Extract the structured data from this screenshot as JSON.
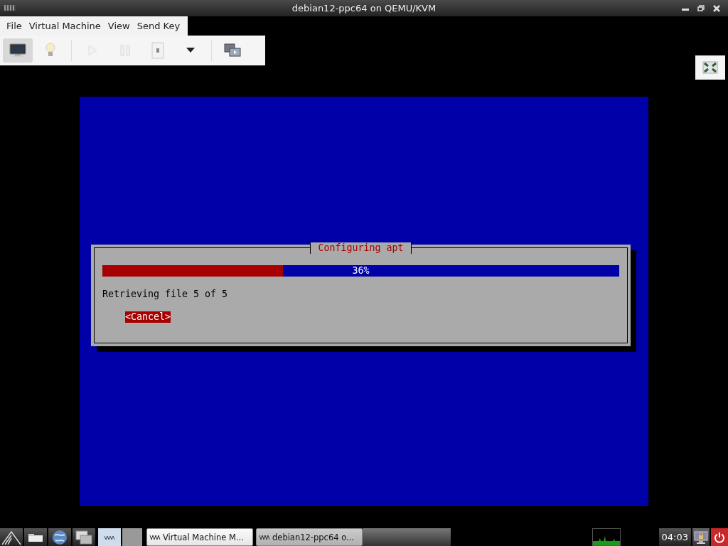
{
  "window": {
    "title": "debian12-ppc64 on QEMU/KVM",
    "controls": [
      {
        "kind": "minimize"
      },
      {
        "kind": "restore"
      },
      {
        "kind": "close"
      }
    ]
  },
  "menu": [
    "File",
    "Virtual Machine",
    "View",
    "Send Key"
  ],
  "toolbar": [
    {
      "kind": "console",
      "selected": true,
      "disabled": false
    },
    {
      "kind": "details",
      "selected": false,
      "disabled": false
    },
    {
      "kind": "run",
      "selected": false,
      "disabled": true
    },
    {
      "kind": "pause",
      "selected": false,
      "disabled": true
    },
    {
      "kind": "shutdown",
      "selected": false,
      "disabled": false
    },
    {
      "kind": "dropdown",
      "selected": false,
      "disabled": false
    },
    {
      "kind": "snapshots",
      "selected": false,
      "disabled": false
    }
  ],
  "installer": {
    "title": "Configuring apt",
    "progress": {
      "level": 0.35,
      "reading": "36%"
    },
    "message": "Retrieving file 5 of 5",
    "button": "<Cancel>"
  },
  "taskbar": {
    "launchers": [
      {
        "kind": "start"
      },
      {
        "kind": "desktop"
      },
      {
        "kind": "browser"
      },
      {
        "kind": "windows"
      },
      {
        "kind": "vm"
      }
    ],
    "tasks": [
      {
        "label": "Virtual Machine M...",
        "selected": false
      },
      {
        "label": "debian12-ppc64 o...",
        "selected": true
      }
    ],
    "clock": "04:03"
  }
}
